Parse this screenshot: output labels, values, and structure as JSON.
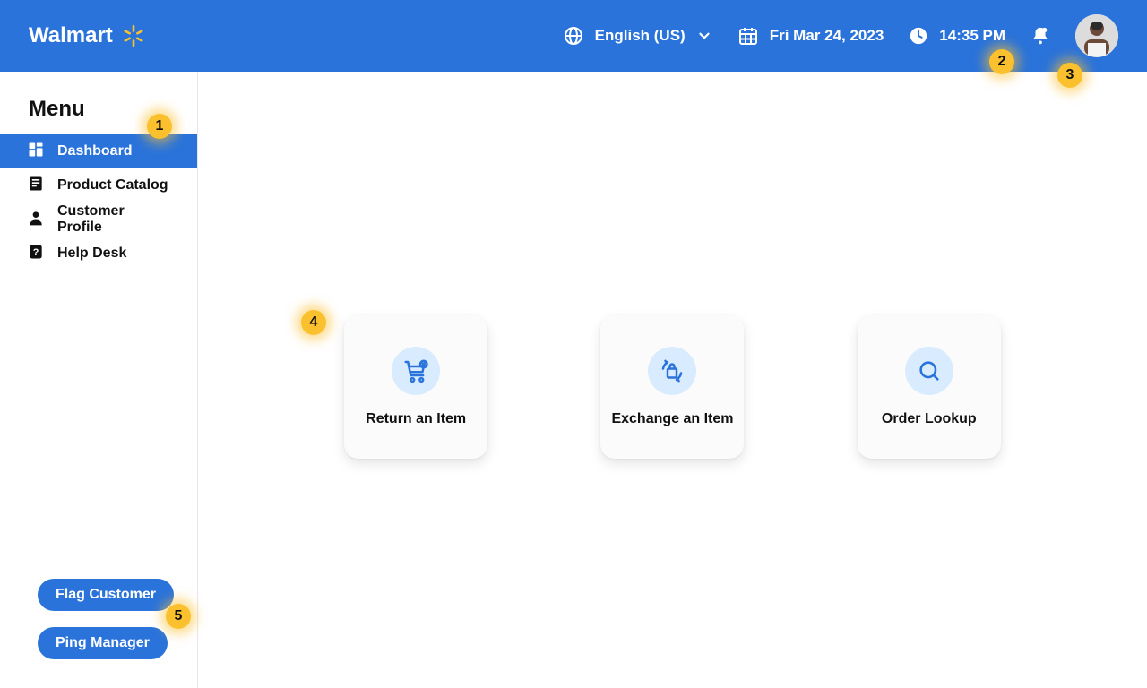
{
  "header": {
    "brand": "Walmart",
    "language": "English (US)",
    "date": "Fri Mar 24, 2023",
    "time": "14:35 PM"
  },
  "sidebar": {
    "title": "Menu",
    "items": [
      {
        "label": "Dashboard",
        "active": true
      },
      {
        "label": "Product Catalog",
        "active": false
      },
      {
        "label": "Customer Profile",
        "active": false
      },
      {
        "label": "Help Desk",
        "active": false
      }
    ],
    "flag_label": "Flag Customer",
    "ping_label": "Ping Manager"
  },
  "dashboard": {
    "cards": [
      {
        "label": "Return an Item"
      },
      {
        "label": "Exchange an Item"
      },
      {
        "label": "Order Lookup"
      }
    ]
  },
  "annotations": {
    "b1": "1",
    "b2": "2",
    "b3": "3",
    "b4": "4",
    "b5": "5"
  },
  "colors": {
    "primary": "#2a73da",
    "accent": "#fbc02d",
    "iconCircle": "#d9ecff"
  }
}
